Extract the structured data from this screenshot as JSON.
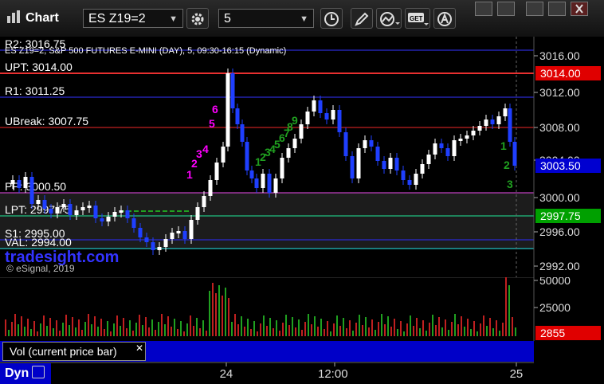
{
  "toolbar": {
    "app_title": "Chart",
    "symbol": "ES Z19=2",
    "interval": "5"
  },
  "chart": {
    "header": "ES Z19=2, S&P 500 FUTURES E-MINI (DAY), 5, 09:30-16:15 (Dynamic)",
    "watermark": "tradesight.com",
    "copyright": "© eSignal, 2019",
    "y_ticks": [
      "3016.00",
      "3012.00",
      "3008.00",
      "3004.00",
      "3000.00",
      "2996.00",
      "2992.00"
    ],
    "x_ticks": [
      "24",
      "12:00",
      "25"
    ],
    "levels": [
      {
        "label": "R2: 3016.75",
        "color": "#2a2ad0"
      },
      {
        "label": "UPT: 3014.00",
        "color": "#e83030"
      },
      {
        "label": "R1: 3011.25",
        "color": "#2a2ad0"
      },
      {
        "label": "UBreak: 3007.75",
        "color": "#c02020"
      },
      {
        "label": "PP: 3000.50",
        "color": "#c040c0"
      },
      {
        "label": "LPT: 2997.75",
        "color": "#20c080"
      },
      {
        "label": "S1: 2995.00",
        "color": "#2a2ad0"
      },
      {
        "label": "VAL: 2994.00",
        "color": "#20c0c0"
      }
    ],
    "price_badges": [
      {
        "text": "3014.00",
        "bg": "#e00000"
      },
      {
        "text": "3003.50",
        "bg": "#0000d0"
      },
      {
        "text": "2997.75",
        "bg": "#00a000"
      }
    ],
    "markers": [
      "6",
      "5",
      "4",
      "3",
      "2",
      "1",
      "9",
      "8",
      "7",
      "6",
      "5",
      "4",
      "3",
      "2",
      "1",
      "3",
      "2",
      "1"
    ],
    "colors": {
      "up": "#ffffff",
      "down": "#1f3fff",
      "background": "#000000"
    }
  },
  "volume": {
    "y_ticks": [
      "50000",
      "25000"
    ],
    "last_badge": "2855",
    "legend": "Vol (current price bar)"
  },
  "footer": {
    "dyn_label": "Dyn"
  }
}
